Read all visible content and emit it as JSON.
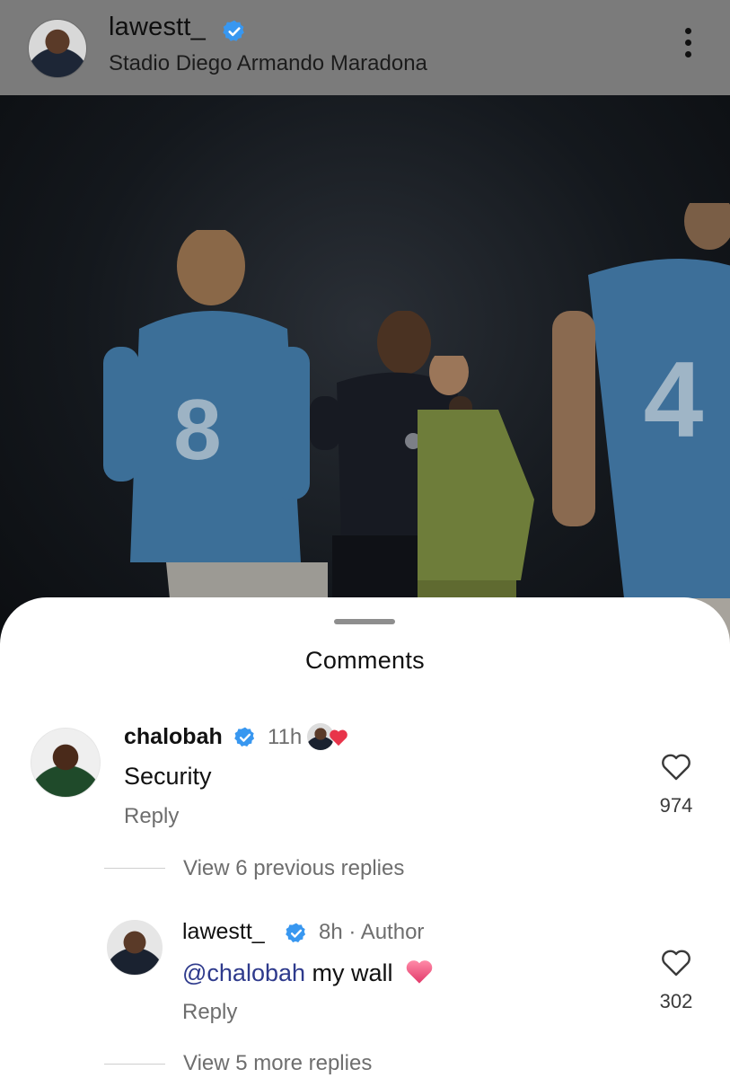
{
  "post": {
    "username": "lawestt_",
    "location": "Stadio Diego Armando Maradona",
    "shirt_numbers": [
      "8",
      "4"
    ]
  },
  "comments_sheet": {
    "title": "Comments",
    "comments": [
      {
        "username": "chalobah",
        "time": "11h",
        "text": "Security",
        "reply_label": "Reply",
        "likes": "974"
      }
    ],
    "view_previous_replies": "View 6 previous replies",
    "replies": [
      {
        "username": "lawestt_",
        "meta": "8h · Author",
        "mention": "@chalobah",
        "text": " my wall",
        "reply_label": "Reply",
        "likes": "302"
      }
    ],
    "view_more_replies": "View 5 more replies"
  },
  "colors": {
    "verified": "#3897f0",
    "heart": "#e8344a",
    "mention": "#2e3a8c"
  },
  "icons": [
    "verified-badge-icon",
    "more-options-icon",
    "heart-outline-icon",
    "heart-emoji-icon"
  ]
}
